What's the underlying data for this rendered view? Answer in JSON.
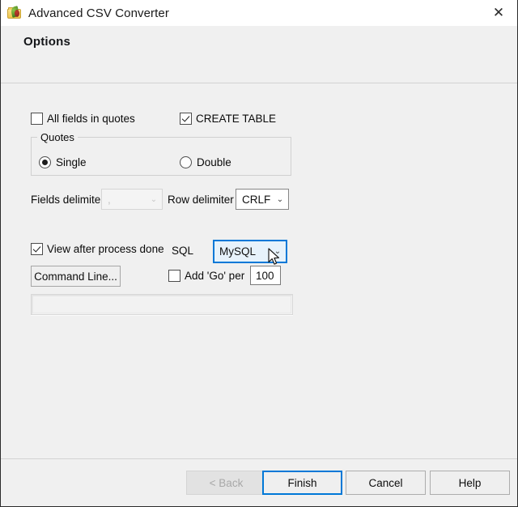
{
  "window": {
    "title": "Advanced CSV Converter",
    "app_icon": "csv-folder-icon",
    "close_label": "✕"
  },
  "header": {
    "title": "Options"
  },
  "options": {
    "all_fields_in_quotes": {
      "label": "All fields in quotes",
      "checked": false
    },
    "create_table": {
      "label": "CREATE TABLE",
      "checked": true
    },
    "quotes_group": {
      "legend": "Quotes",
      "single": {
        "label": "Single",
        "selected": true
      },
      "double": {
        "label": "Double",
        "selected": false
      }
    },
    "fields_delimiter": {
      "label": "Fields delimiter",
      "value": ",",
      "enabled": false,
      "arrow": "⌄"
    },
    "row_delimiter": {
      "label": "Row delimiter",
      "value": "CRLF",
      "enabled": true,
      "arrow": "⌄"
    },
    "view_after_process": {
      "label": "View after process done",
      "checked": true
    },
    "sql_label": "SQL",
    "sql_dialect": {
      "value": "MySQL",
      "focused": true,
      "arrow": "⌄"
    },
    "command_line_button": "Command Line...",
    "add_go": {
      "label": "Add 'Go' per",
      "checked": false,
      "count": "100"
    }
  },
  "progress": {
    "value": ""
  },
  "footer": {
    "back": {
      "label": "< Back",
      "enabled": false
    },
    "finish": {
      "label": "Finish",
      "default": true
    },
    "cancel": {
      "label": "Cancel"
    },
    "help": {
      "label": "Help"
    }
  },
  "colors": {
    "accent": "#0078d7",
    "panel": "#f0f0f0",
    "titlebar": "#ffffff"
  }
}
